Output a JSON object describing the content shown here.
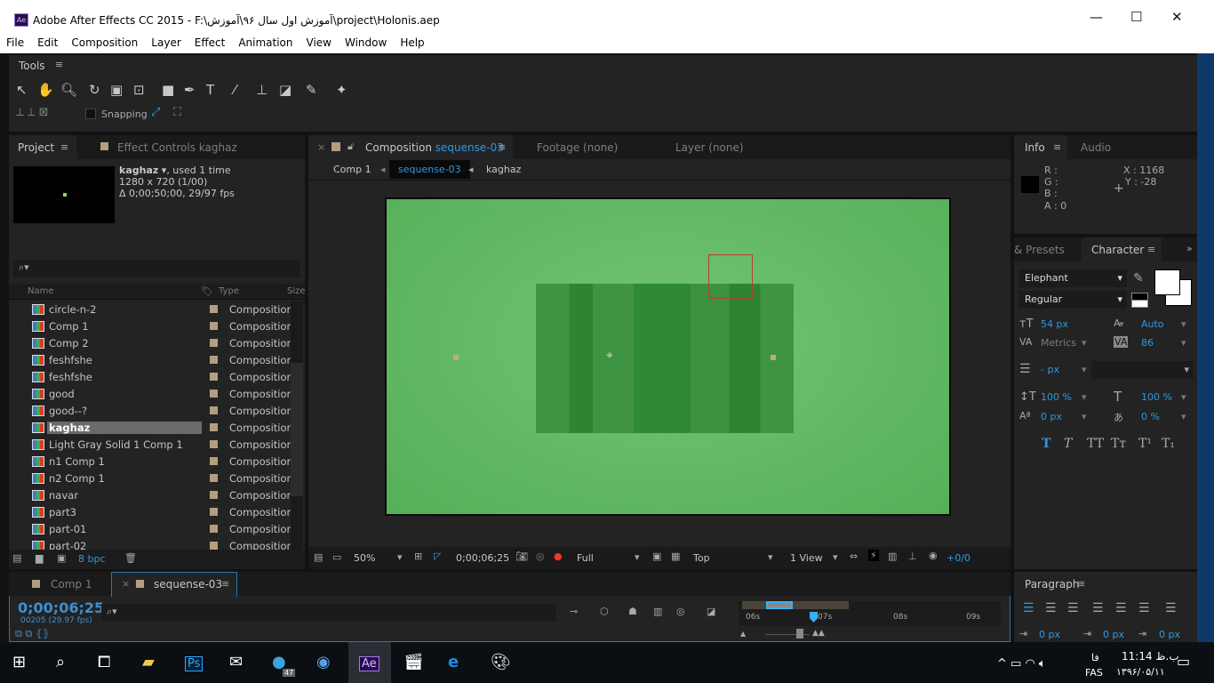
{
  "window": {
    "title": "Adobe After Effects CC 2015 - F:\\آموزش اول سال ۹۶\\آموزش\\project\\Holonis.aep",
    "app_icon": "Ae",
    "minimize": "—",
    "maximize": "☐",
    "close": "✕"
  },
  "menu": [
    "File",
    "Edit",
    "Composition",
    "Layer",
    "Effect",
    "Animation",
    "View",
    "Window",
    "Help"
  ],
  "tools": {
    "title": "Tools",
    "snapping": "Snapping"
  },
  "project": {
    "tab": "Project",
    "effect_tab": "Effect Controls kaghaz",
    "selected_name": "kaghaz",
    "used": ", used 1 time",
    "size": "1280 x 720 (1/00)",
    "duration": "Δ 0;00;50;00, 29/97 fps",
    "columns": {
      "name": "Name",
      "type": "Type",
      "size": "Size"
    },
    "items": [
      {
        "name": "circle-n-2",
        "type": "Composition"
      },
      {
        "name": "Comp 1",
        "type": "Composition"
      },
      {
        "name": "Comp 2",
        "type": "Composition"
      },
      {
        "name": "feshfshe",
        "type": "Composition"
      },
      {
        "name": "feshfshe",
        "type": "Composition"
      },
      {
        "name": "good",
        "type": "Composition"
      },
      {
        "name": "good--?",
        "type": "Composition"
      },
      {
        "name": "kaghaz",
        "type": "Composition",
        "selected": true
      },
      {
        "name": "Light Gray Solid 1 Comp 1",
        "type": "Composition"
      },
      {
        "name": "n1 Comp 1",
        "type": "Composition"
      },
      {
        "name": "n2 Comp 1",
        "type": "Composition"
      },
      {
        "name": "navar",
        "type": "Composition"
      },
      {
        "name": "part3",
        "type": "Composition"
      },
      {
        "name": "part-01",
        "type": "Composition"
      },
      {
        "name": "part-02",
        "type": "Composition"
      }
    ],
    "bpc": "8 bpc"
  },
  "viewer": {
    "tab_prefix": "Composition",
    "tab_comp": "sequense-03",
    "footage_tab": "Footage (none)",
    "layer_tab": "Layer (none)",
    "breadcrumbs": [
      "Comp 1",
      "sequense-03",
      "kaghaz"
    ],
    "zoom": "50%",
    "timecode": "0;00;06;25",
    "resolution": "Full",
    "view": "Top",
    "views": "1 View",
    "exposure": "+0/0"
  },
  "info": {
    "tab": "Info",
    "audio_tab": "Audio",
    "r": "R :",
    "g": "G :",
    "b": "B :",
    "a": "A : 0",
    "x": "X : 1168",
    "y": "Y : -28"
  },
  "character": {
    "presets_tab": "& Presets",
    "tab": "Character",
    "font": "Elephant",
    "style": "Regular",
    "size": "54 px",
    "leading": "Auto",
    "kerning": "Metrics",
    "tracking": "86",
    "stroke": "- px",
    "vscale": "100 %",
    "hscale": "100 %",
    "baseline": "0 px",
    "tsume": "0 %",
    "styles": [
      "T",
      "T",
      "TT",
      "Tт",
      "T¹",
      "T₁"
    ]
  },
  "paragraph": {
    "tab": "Paragraph",
    "indent_left": "0 px",
    "indent_first": "0 px",
    "indent_right": "0 px"
  },
  "timeline": {
    "tabs": [
      "Comp 1",
      "sequense-03"
    ],
    "timecode": "0;00;06;25",
    "frames": "00205 (29.97 fps)",
    "ruler": [
      "06s",
      "07s",
      "08s",
      "09s"
    ]
  },
  "taskbar": {
    "telegram_badge": "47",
    "lang_short": "فا",
    "lang": "FAS",
    "time": "11:14 ب.ظ",
    "date": "۱۳۹۶/۰۵/۱۱"
  }
}
